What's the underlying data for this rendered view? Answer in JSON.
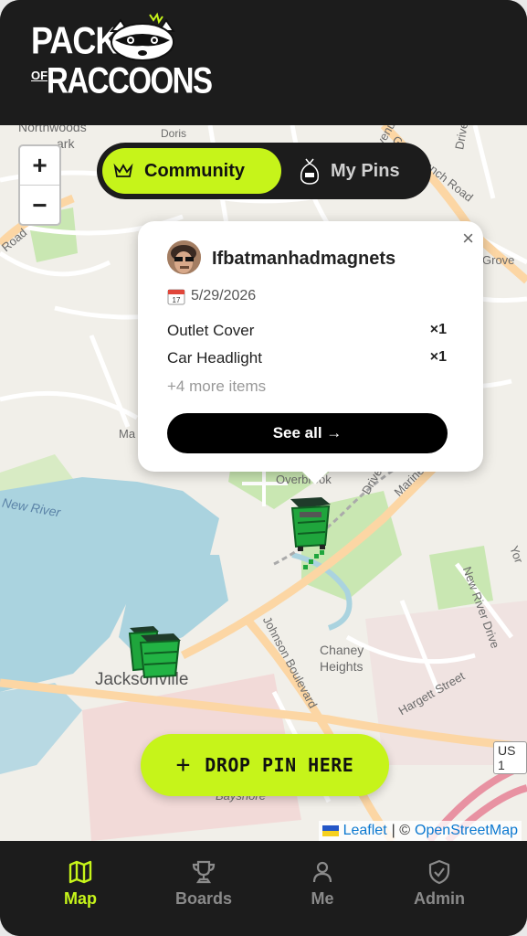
{
  "header": {
    "logo_line1": "PACK",
    "logo_of": "OF",
    "logo_line2": "RACCOONS"
  },
  "map": {
    "zoom_in": "+",
    "zoom_out": "−",
    "labels": {
      "northwoods": "Northwoods",
      "park": "ark",
      "doris": "Doris",
      "gum_branch": "Gum Branch Road",
      "ave": "Avenue",
      "drive_top": "Drive",
      "grove": "Grove",
      "road_left": "Road",
      "ma": "Ma",
      "new_river": "New River",
      "overbrook": "Overbrook",
      "drive_mid": "Drive",
      "marine": "Marine",
      "new_river_drive": "New River Drive",
      "york": "Yor",
      "johnson_blvd": "Johnson Boulevard",
      "chaney": "Chaney",
      "heights": "Heights",
      "hargett": "Hargett Street",
      "jacksonville": "Jacksonville",
      "bayshore": "Bayshore",
      "us1": "US 1"
    },
    "attribution": {
      "leaflet": "Leaflet",
      "sep": "| ©",
      "osm": "OpenStreetMap"
    }
  },
  "toggle": {
    "community": "Community",
    "my_pins": "My Pins",
    "community_icon": "crown-icon",
    "my_pins_icon": "trash-bag-icon"
  },
  "popup": {
    "username": "Ifbatmanhadmagnets",
    "date": "5/29/2026",
    "items": [
      {
        "name": "Outlet Cover",
        "qty": "×1"
      },
      {
        "name": "Car Headlight",
        "qty": "×1"
      }
    ],
    "more": "+4 more items",
    "see_all": "See all →",
    "close": "×"
  },
  "drop_pin": {
    "label": "DROP PIN HERE",
    "plus": "+"
  },
  "nav": {
    "tabs": [
      {
        "label": "Map",
        "icon": "map-icon",
        "active": true
      },
      {
        "label": "Boards",
        "icon": "trophy-icon",
        "active": false
      },
      {
        "label": "Me",
        "icon": "user-icon",
        "active": false
      },
      {
        "label": "Admin",
        "icon": "shield-check-icon",
        "active": false
      }
    ]
  },
  "colors": {
    "accent": "#c6f41a",
    "dark": "#1c1c1c",
    "map_bg": "#f1efe9",
    "water": "#aad3df",
    "road_major": "#fcd6a4",
    "link": "#0b78d0"
  }
}
